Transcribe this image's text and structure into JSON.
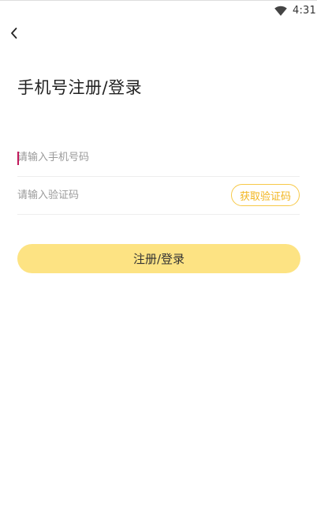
{
  "status_bar": {
    "time": "4:31",
    "wifi_icon": "wifi-icon"
  },
  "header": {
    "back_icon": "chevron-left-icon",
    "title": "手机号注册/登录"
  },
  "form": {
    "phone_placeholder": "请输入手机号码",
    "phone_value": "",
    "code_placeholder": "请输入验证码",
    "code_value": "",
    "get_code_label": "获取验证码",
    "submit_label": "注册/登录"
  },
  "colors": {
    "accent": "#f7c948",
    "accent_text": "#f2b51e",
    "button_fill": "#fde383",
    "caret": "#c2185b"
  }
}
